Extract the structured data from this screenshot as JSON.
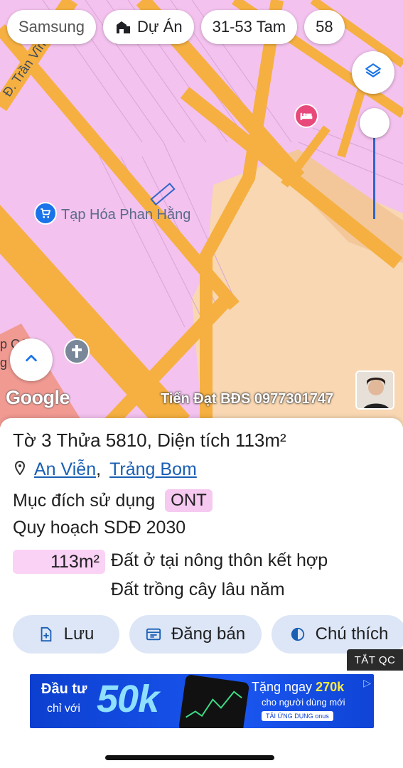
{
  "map": {
    "chips": [
      {
        "label": "Samsung",
        "icon": "app-icon"
      },
      {
        "label": "Dự Án",
        "icon": "building-icon"
      },
      {
        "label": "31-53 Tam",
        "icon": ""
      },
      {
        "label": "58",
        "icon": ""
      }
    ],
    "road_label": "Đ. Trần Vĩnh Lộc",
    "shop_label": "Tạp Hóa Phan Hằng",
    "partial_label_1": "p C    Vô",
    "partial_label_2": "g    ội",
    "google_logo": "Google",
    "watermark": "Tiến Đạt BĐS 0977301747",
    "colors": {
      "residential": "#f3c2ee",
      "road": "#f5b041",
      "agricultural": "#f8d7b2",
      "public": "#f09a92",
      "accent": "#2f66c8"
    }
  },
  "parcel": {
    "title": "Tờ 3 Thửa 5810, Diện tích 113m²",
    "ward": "An Viễn",
    "district": "Trảng Bom",
    "separator": ",",
    "purpose_label": "Mục đích sử dụng",
    "purpose_code": "ONT",
    "plan_label": "Quy hoạch SDĐ 2030",
    "area_value": "113m²",
    "area_type_1": "Đất ở tại nông thôn kết hợp",
    "area_type_2": "Đất trồng cây lâu năm"
  },
  "actions": {
    "save": "Lưu",
    "post_sale": "Đăng bán",
    "legend": "Chú thích"
  },
  "ad": {
    "hide_ads": "TẮT QC",
    "line1": "Đầu tư",
    "line2": "chỉ với",
    "big": "50k",
    "offer_prefix": "Tặng ngay ",
    "offer_value": "270k",
    "offer_sub": "cho người dùng mới",
    "offer_cta": "TẢI ỨNG DỤNG onus"
  }
}
